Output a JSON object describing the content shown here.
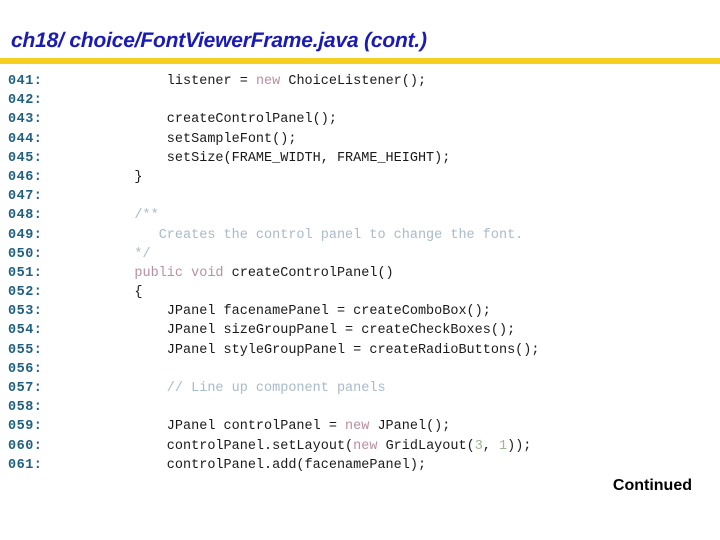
{
  "header": {
    "title": "ch18/ choice/FontViewerFrame.java  (cont.)",
    "rule_color": "#F5D020",
    "title_color": "#1A1AB8"
  },
  "footer": {
    "continued_label": "Continued"
  },
  "syntax_colors": {
    "line_number": "#1F6080",
    "plain": "#1A1A1A",
    "keyword": "#B88FA0",
    "comment": "#A9BAC9",
    "number": "#9FB497"
  },
  "code": {
    "language": "java",
    "first_line": 41,
    "last_line": 61,
    "lines": [
      {
        "number": "041:",
        "text": "        listener = new ChoiceListener();",
        "tokens": [
          {
            "t": "        listener = ",
            "k": "plain"
          },
          {
            "t": "new",
            "k": "keyword"
          },
          {
            "t": " ChoiceListener();",
            "k": "plain"
          }
        ]
      },
      {
        "number": "042:",
        "text": "",
        "tokens": []
      },
      {
        "number": "043:",
        "text": "        createControlPanel();",
        "tokens": [
          {
            "t": "        createControlPanel();",
            "k": "plain"
          }
        ]
      },
      {
        "number": "044:",
        "text": "        setSampleFont();",
        "tokens": [
          {
            "t": "        setSampleFont();",
            "k": "plain"
          }
        ]
      },
      {
        "number": "045:",
        "text": "        setSize(FRAME_WIDTH, FRAME_HEIGHT);",
        "tokens": [
          {
            "t": "        setSize(FRAME_WIDTH, FRAME_HEIGHT);",
            "k": "plain"
          }
        ]
      },
      {
        "number": "046:",
        "text": "    }",
        "tokens": [
          {
            "t": "    }",
            "k": "plain"
          }
        ]
      },
      {
        "number": "047:",
        "text": "",
        "tokens": []
      },
      {
        "number": "048:",
        "text": "    /**",
        "tokens": [
          {
            "t": "    /**",
            "k": "comment"
          }
        ]
      },
      {
        "number": "049:",
        "text": "       Creates the control panel to change the font.",
        "tokens": [
          {
            "t": "       Creates the control panel to change the font.",
            "k": "comment"
          }
        ]
      },
      {
        "number": "050:",
        "text": "    */",
        "tokens": [
          {
            "t": "    */",
            "k": "comment"
          }
        ]
      },
      {
        "number": "051:",
        "text": "    public void createControlPanel()",
        "tokens": [
          {
            "t": "    ",
            "k": "plain"
          },
          {
            "t": "public void",
            "k": "keyword"
          },
          {
            "t": " createControlPanel()",
            "k": "plain"
          }
        ]
      },
      {
        "number": "052:",
        "text": "    {",
        "tokens": [
          {
            "t": "    {",
            "k": "plain"
          }
        ]
      },
      {
        "number": "053:",
        "text": "        JPanel facenamePanel = createComboBox();",
        "tokens": [
          {
            "t": "        JPanel facenamePanel = createComboBox();",
            "k": "plain"
          }
        ]
      },
      {
        "number": "054:",
        "text": "        JPanel sizeGroupPanel = createCheckBoxes();",
        "tokens": [
          {
            "t": "        JPanel sizeGroupPanel = createCheckBoxes();",
            "k": "plain"
          }
        ]
      },
      {
        "number": "055:",
        "text": "        JPanel styleGroupPanel = createRadioButtons();",
        "tokens": [
          {
            "t": "        JPanel styleGroupPanel = createRadioButtons();",
            "k": "plain"
          }
        ]
      },
      {
        "number": "056:",
        "text": "",
        "tokens": []
      },
      {
        "number": "057:",
        "text": "        // Line up component panels",
        "tokens": [
          {
            "t": "        // Line up component panels",
            "k": "comment"
          }
        ]
      },
      {
        "number": "058:",
        "text": "",
        "tokens": []
      },
      {
        "number": "059:",
        "text": "        JPanel controlPanel = new JPanel();",
        "tokens": [
          {
            "t": "        JPanel controlPanel = ",
            "k": "plain"
          },
          {
            "t": "new",
            "k": "keyword"
          },
          {
            "t": " JPanel();",
            "k": "plain"
          }
        ]
      },
      {
        "number": "060:",
        "text": "        controlPanel.setLayout(new GridLayout(3, 1));",
        "tokens": [
          {
            "t": "        controlPanel.setLayout(",
            "k": "plain"
          },
          {
            "t": "new",
            "k": "keyword"
          },
          {
            "t": " GridLayout(",
            "k": "plain"
          },
          {
            "t": "3",
            "k": "number"
          },
          {
            "t": ", ",
            "k": "plain"
          },
          {
            "t": "1",
            "k": "number"
          },
          {
            "t": "));",
            "k": "plain"
          }
        ]
      },
      {
        "number": "061:",
        "text": "        controlPanel.add(facenamePanel);",
        "tokens": [
          {
            "t": "        controlPanel.add(facenamePanel);",
            "k": "plain"
          }
        ]
      }
    ]
  }
}
